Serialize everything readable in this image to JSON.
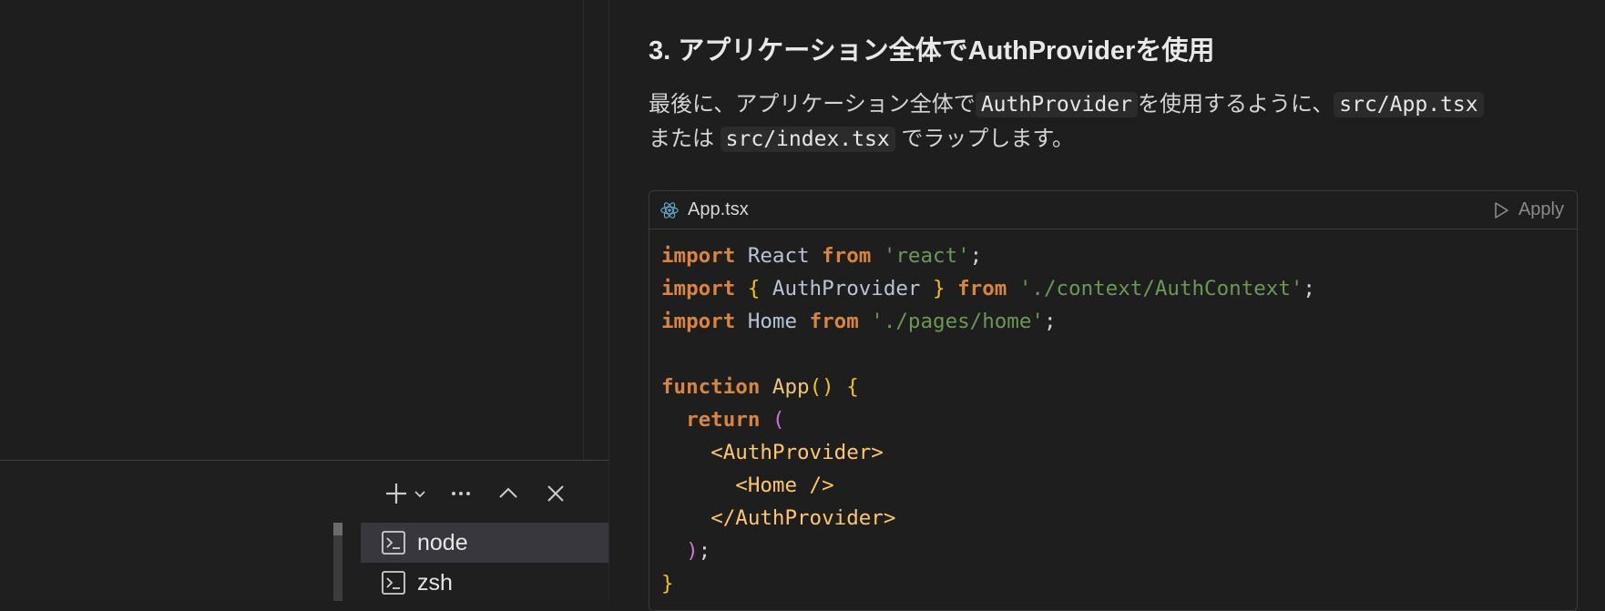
{
  "chat": {
    "heading": "3. アプリケーション全体でAuthProviderを使用",
    "para": {
      "t1": "最後に、アプリケーション全体で",
      "c1": "AuthProvider",
      "t2": "を使用するように、",
      "c2": "src/App.tsx",
      "t3": "または",
      "c3": "src/index.tsx",
      "t4": "でラップします。"
    },
    "code_block": {
      "filename": "App.tsx",
      "apply_label": "Apply",
      "file_icon": "react-icon",
      "apply_icon": "play-icon",
      "lines": [
        [
          {
            "t": "import",
            "c": "kw"
          },
          {
            "t": " React ",
            "c": "id"
          },
          {
            "t": "from",
            "c": "kw"
          },
          {
            "t": " ",
            "c": "pun"
          },
          {
            "t": "'react'",
            "c": "str"
          },
          {
            "t": ";",
            "c": "pun"
          }
        ],
        [
          {
            "t": "import",
            "c": "kw"
          },
          {
            "t": " ",
            "c": "pun"
          },
          {
            "t": "{",
            "c": "brace"
          },
          {
            "t": " AuthProvider ",
            "c": "id"
          },
          {
            "t": "}",
            "c": "brace"
          },
          {
            "t": " ",
            "c": "pun"
          },
          {
            "t": "from",
            "c": "kw"
          },
          {
            "t": " ",
            "c": "pun"
          },
          {
            "t": "'./context/AuthContext'",
            "c": "str"
          },
          {
            "t": ";",
            "c": "pun"
          }
        ],
        [
          {
            "t": "import",
            "c": "kw"
          },
          {
            "t": " Home ",
            "c": "id"
          },
          {
            "t": "from",
            "c": "kw"
          },
          {
            "t": " ",
            "c": "pun"
          },
          {
            "t": "'./pages/home'",
            "c": "str"
          },
          {
            "t": ";",
            "c": "pun"
          }
        ],
        [],
        [
          {
            "t": "function",
            "c": "kw"
          },
          {
            "t": " ",
            "c": "pun"
          },
          {
            "t": "App",
            "c": "fn"
          },
          {
            "t": "()",
            "c": "brace"
          },
          {
            "t": " ",
            "c": "pun"
          },
          {
            "t": "{",
            "c": "brace"
          }
        ],
        [
          {
            "t": "  ",
            "c": "pun"
          },
          {
            "t": "return",
            "c": "kw"
          },
          {
            "t": " ",
            "c": "pun"
          },
          {
            "t": "(",
            "c": "paren"
          }
        ],
        [
          {
            "t": "    ",
            "c": "pun"
          },
          {
            "t": "<AuthProvider>",
            "c": "tag"
          }
        ],
        [
          {
            "t": "      ",
            "c": "pun"
          },
          {
            "t": "<Home />",
            "c": "tag"
          }
        ],
        [
          {
            "t": "    ",
            "c": "pun"
          },
          {
            "t": "</AuthProvider>",
            "c": "tag"
          }
        ],
        [
          {
            "t": "  ",
            "c": "pun"
          },
          {
            "t": ")",
            "c": "paren"
          },
          {
            "t": ";",
            "c": "pun"
          }
        ],
        [
          {
            "t": "}",
            "c": "brace"
          }
        ]
      ]
    }
  },
  "terminal_panel": {
    "toolbar_icons": [
      "plus-icon",
      "chevron-down-icon",
      "ellipsis-icon",
      "chevron-up-icon",
      "close-icon"
    ],
    "terminals": [
      {
        "label": "node",
        "selected": true,
        "icon": "terminal-icon"
      },
      {
        "label": "zsh",
        "selected": false,
        "icon": "terminal-icon"
      }
    ]
  },
  "colors": {
    "background": "#1e1e1e",
    "keyword": "#d9853b",
    "string": "#6a9955",
    "brace": "#f0c419",
    "paren": "#c678dd",
    "jsx_tag": "#ffc66d",
    "selected_terminal": "#37373d"
  }
}
